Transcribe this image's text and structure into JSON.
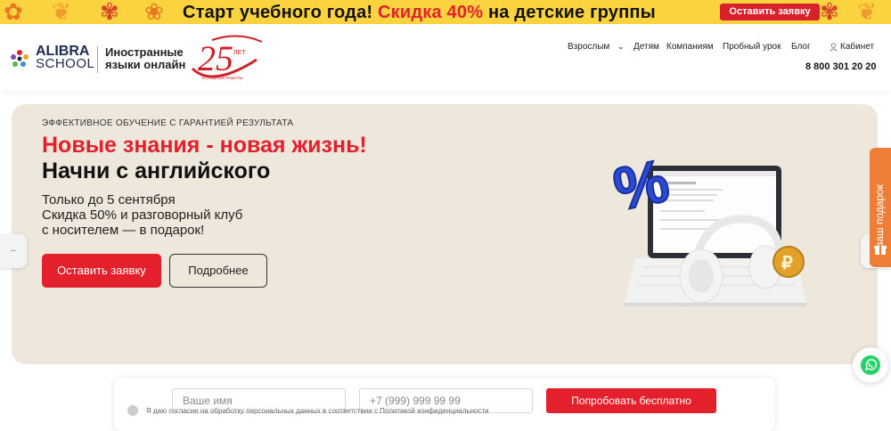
{
  "promo": {
    "text_start": "Старт учебного года! ",
    "text_discount": "Скидка 40%",
    "text_end": " на детские группы",
    "button": "Оставить заявку"
  },
  "header": {
    "logo_line1": "ALIBRA",
    "logo_line2": "SCHOOL",
    "tagline_line1": "Иностранные",
    "tagline_line2": "языки онлайн",
    "anniversary_number": "25",
    "anniversary_label": "ЛЕТ",
    "anniversary_caption": "УСПЕШНОЙ РАБОТЫ",
    "nav": [
      "Взрослым",
      "Детям",
      "Компаниям",
      "Пробный урок",
      "Блог"
    ],
    "cabinet": "Кабинет",
    "phone": "8 800 301 20 20"
  },
  "hero": {
    "eyebrow": "ЭФФЕКТИВНОЕ ОБУЧЕНИЕ С ГАРАНТИЕЙ РЕЗУЛЬТАТА",
    "title_red": "Новые знания - новая жизнь!",
    "title_black": "Начни с английского",
    "sub_line1": "Только до 5 сентября",
    "sub_line2": "Скидка 50% и разговорный клуб",
    "sub_line3": "с носителем — в подарок!",
    "primary_button": "Оставить заявку",
    "secondary_button": "Подробнее"
  },
  "side": {
    "gift_tab": "ваш подарок"
  },
  "form": {
    "name_placeholder": "Ваше имя",
    "phone_placeholder": "+7 (999) 999 99 99",
    "submit": "Попробовать бесплатно",
    "consent": "Я даю согласие на обработку персональных данных в соответствии с Политикой конфиденциальности"
  },
  "colors": {
    "brand_red": "#e3202b",
    "promo_yellow": "#fbd33f",
    "hero_bg": "#eee7dc",
    "gift_orange": "#ee7d35"
  }
}
